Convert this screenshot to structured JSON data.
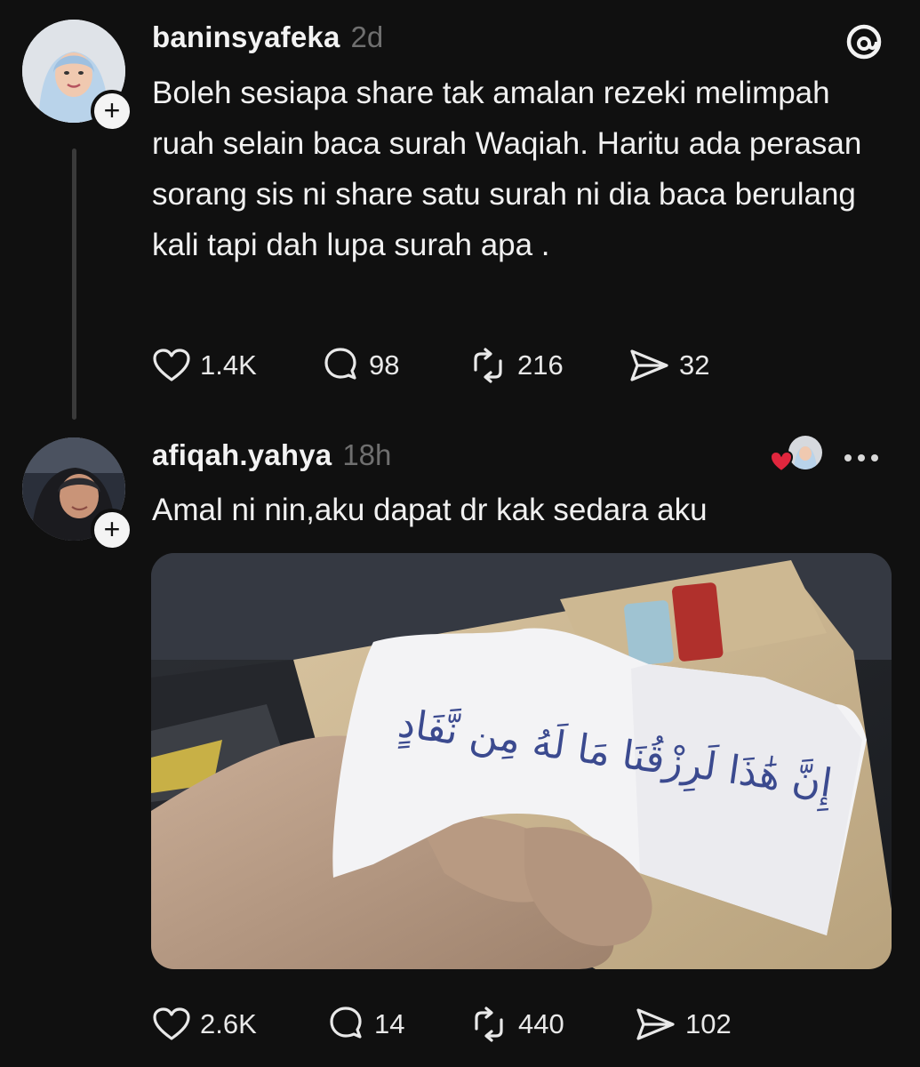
{
  "posts": [
    {
      "username": "baninsyafeka",
      "time": "2d",
      "text": "Boleh sesiapa share tak amalan rezeki melimpah ruah selain baca surah Waqiah. Haritu ada perasan sorang sis ni share satu surah ni dia baca berulang kali tapi dah lupa surah apa .",
      "likes": "1.4K",
      "replies": "98",
      "reposts": "216",
      "shares": "32"
    },
    {
      "username": "afiqah.yahya",
      "time": "18h",
      "text": "Amal ni nin,aku dapat dr kak sedara aku",
      "likes": "2.6K",
      "replies": "14",
      "reposts": "440",
      "shares": "102",
      "image_text": "إِنَّ هَٰذَا لَرِزْقُنَا مَا لَهُ مِن نَّفَادٍ"
    }
  ],
  "icons": {
    "header": "threads-logo-icon",
    "follow": "plus-icon",
    "like": "heart-icon",
    "reply": "comment-icon",
    "repost": "repost-icon",
    "share": "send-icon",
    "more": "more-options-icon",
    "liked_by": "liked-heart-icon"
  },
  "colors": {
    "background": "#101010",
    "secondary_text": "#6f6f6f",
    "liked_heart": "#e0263d"
  }
}
